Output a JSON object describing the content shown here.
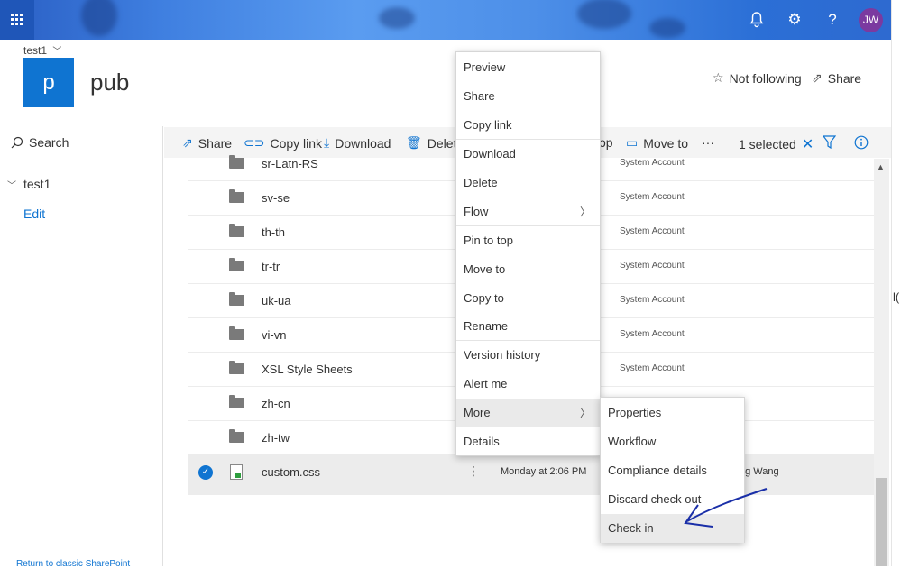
{
  "suitebar": {
    "avatar_initials": "JW",
    "accent_color": "#3f7fe0",
    "icons": [
      "app-launcher-icon",
      "bell-icon",
      "gear-icon",
      "help-icon"
    ]
  },
  "site": {
    "breadcrumb": "test1",
    "logo_letter": "p",
    "title": "pub",
    "follow_label": "Not following",
    "share_label": "Share"
  },
  "leftnav": {
    "search_label": "Search",
    "group_label": "test1",
    "edit_label": "Edit",
    "bottom_label": "Return to classic SharePoint"
  },
  "command_bar": {
    "share": "Share",
    "copy_link": "Copy link",
    "download": "Download",
    "delete": "Delete",
    "pin_to_top_partial": "op",
    "move_to": "Move to",
    "more": "···",
    "selected": "1 selected"
  },
  "files": [
    {
      "name": "sr-Latn-RS",
      "modified_by": "System Account"
    },
    {
      "name": "sv-se",
      "modified_by": "System Account"
    },
    {
      "name": "th-th",
      "modified_by": "System Account"
    },
    {
      "name": "tr-tr",
      "modified_by": "System Account"
    },
    {
      "name": "uk-ua",
      "modified_by": "System Account"
    },
    {
      "name": "vi-vn",
      "modified_by": "System Account"
    },
    {
      "name": "XSL Style Sheets",
      "modified_by": "System Account"
    },
    {
      "name": "zh-cn",
      "modified_by": ""
    },
    {
      "name": "zh-tw",
      "modified_by": ""
    }
  ],
  "selected_file": {
    "name": "custom.css",
    "more_glyph": "⋮",
    "modified": "Monday at 2:06 PM",
    "modified_by": "ng Wang"
  },
  "context_menu": {
    "items": [
      "Preview",
      "Share",
      "Copy link",
      "Download",
      "Delete",
      "Flow",
      "Pin to top",
      "Move to",
      "Copy to",
      "Rename",
      "Version history",
      "Alert me",
      "More",
      "Details"
    ]
  },
  "submenu": {
    "items": [
      "Properties",
      "Workflow",
      "Compliance details",
      "Discard check out",
      "Check in"
    ]
  },
  "edge_text": "l("
}
